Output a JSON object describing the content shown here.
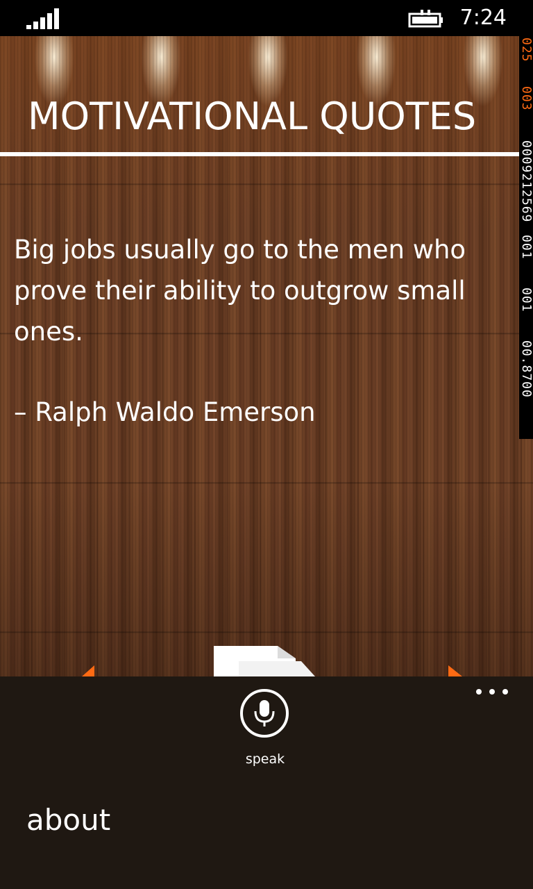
{
  "status_bar": {
    "time": "7:24",
    "signal_icon": "signal-bars-icon",
    "battery_icon": "battery-charging-icon"
  },
  "app": {
    "title": "MOTIVATIONAL QUOTES"
  },
  "quote": {
    "text": "Big jobs usually go to the men who prove their ability to outgrow small ones.",
    "author": "– Ralph Waldo Emerson"
  },
  "debug_counters": [
    "025",
    "003",
    "0009212569",
    "001",
    "001",
    "00.8700"
  ],
  "app_bar": {
    "speak_label": "speak",
    "speak_icon": "microphone-icon",
    "more_icon": "ellipsis-icon",
    "menu_items": [
      "about"
    ]
  },
  "colors": {
    "app_bar_bg": "#1f1812",
    "wood": "#5a3520",
    "counter_accent": "#ff6a13"
  }
}
